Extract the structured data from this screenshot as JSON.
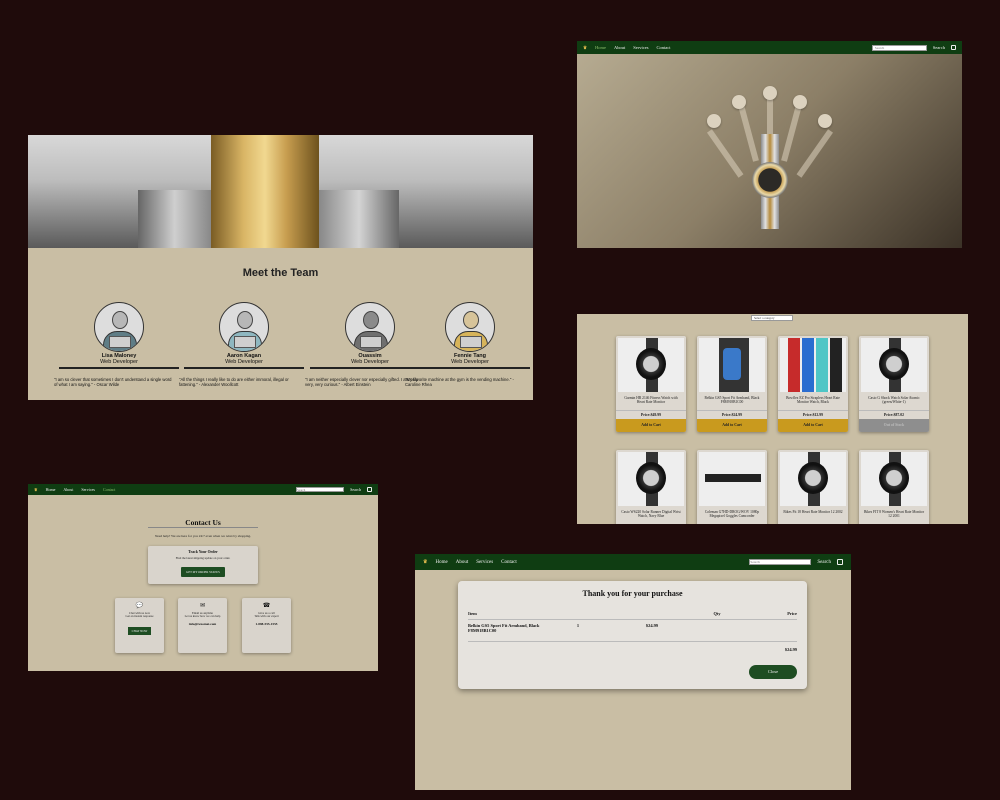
{
  "nav": {
    "links": [
      "Home",
      "About",
      "Services",
      "Contact"
    ],
    "search_placeholder": "Search",
    "search_button": "Search"
  },
  "team": {
    "heading": "Meet the Team",
    "members": [
      {
        "name": "Lisa Maloney",
        "role": "Web Developer",
        "quote": "\"I am so clever that sometimes I don't understand a single word of what I am saying.\" - Oscar Wilde"
      },
      {
        "name": "Aaron Kagan",
        "role": "Web Developer",
        "quote": "\"All the things I really like to do are either immoral, illegal or fattening.\" - Alexander Woollcott"
      },
      {
        "name": "Ouassim",
        "role": "Web Developer",
        "quote": "\"I am neither especially clever nor especially gifted. I am only very, very curious.\" - Albert Einstein"
      },
      {
        "name": "Fennie Tang",
        "role": "Web Developer",
        "quote": "\"My favorite machine at the gym is the vending machine.\" - Caroline Rhea"
      }
    ]
  },
  "products": {
    "category_select": "Select a category",
    "items": [
      {
        "title": "Garmin HR 2146 Fitness Watch with Heart Rate Monitor",
        "price": "Price:$49.99",
        "button": "Add to Cart",
        "disabled": false
      },
      {
        "title": "Belkin GS5 Sport Fit Armband, Black F8M918B1C00",
        "price": "Price:$24.99",
        "button": "Add to Cart",
        "disabled": false
      },
      {
        "title": "Bowflex EZ Pro Strapless Heart Rate Monitor Watch, Black",
        "price": "Price:$12.99",
        "button": "Add to Cart",
        "disabled": false
      },
      {
        "title": "Casio G Shock Watch Solar Atomic (green/White-1)",
        "price": "Price:$87.02",
        "button": "Out of Stock",
        "disabled": true
      },
      {
        "title": "Casio WS220 Solar Runner Digital Wrist Watch, Navy Blue",
        "price": "",
        "button": "",
        "disabled": false
      },
      {
        "title": "Coleman G7HD-DROG/WOV 1080p Megapixel Goggles Camcorder",
        "price": "",
        "button": "",
        "disabled": false
      },
      {
        "title": "Bikes Fit 18 Heart Rate Monitor 12 2002",
        "price": "",
        "button": "",
        "disabled": false
      },
      {
        "title": "Bikes FIT 8 Women's Heart Rate Monitor 12 2001",
        "price": "",
        "button": "",
        "disabled": false
      }
    ]
  },
  "contact": {
    "heading": "Contact Us",
    "subtitle": "Need help? We are here for you 24/7 even when we relax by shopping.",
    "track_title": "Track Your Order",
    "track_desc": "Find the latest shipping update on your order.",
    "track_button": "GET MY ORDER STATUS",
    "boxes": [
      {
        "icon": "chat",
        "l1": "Chat with us now",
        "l2": "Get an instant response",
        "value": "",
        "button": "CHAT NOW"
      },
      {
        "icon": "mail",
        "l1": "Email us anytime",
        "l2": "Let us know how we can help",
        "value": "info@rexomet.com",
        "button": ""
      },
      {
        "icon": "phone",
        "l1": "Give us a call",
        "l2": "Talk with our expert",
        "value": "1-888-555-1555",
        "button": ""
      }
    ]
  },
  "receipt": {
    "title": "Thank you for your purchase",
    "headers": [
      "Item",
      "Qty",
      "Price"
    ],
    "item": "Belkin GS5 Sport Fit Armband, Black F8M918B1C00",
    "qty": "1",
    "price": "$24.99",
    "total": "$24.99",
    "close": "Close"
  },
  "colors": {
    "nav_green": "#0f3d12",
    "gold": "#c99a1e",
    "bg": "#1f0b0b",
    "panel": "#c9bea4"
  }
}
